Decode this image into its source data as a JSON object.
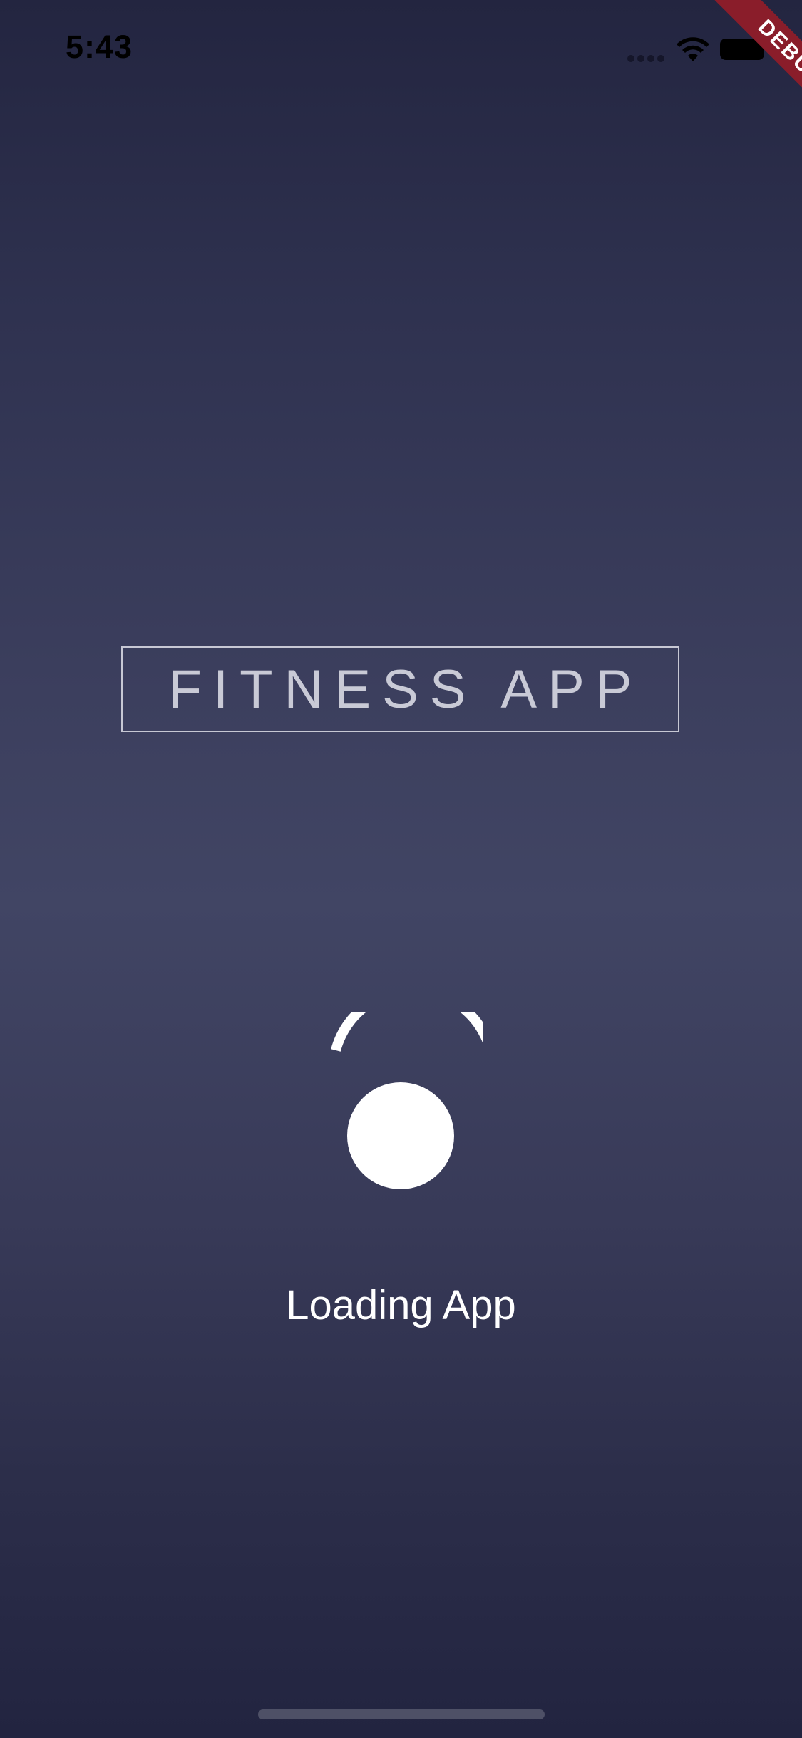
{
  "status_bar": {
    "time": "5:43"
  },
  "debug_banner": {
    "label": "DEBUG",
    "color": "#8a1d2a"
  },
  "splash": {
    "title": "FITNESS APP",
    "loading_label": "Loading App"
  },
  "icons": {
    "signal": "cellular-signal-icon",
    "wifi": "wifi-icon",
    "battery": "battery-icon",
    "spinner": "loading-spinner-icon"
  },
  "colors": {
    "background_top": "#232540",
    "background_mid": "#414564",
    "title_text": "#c9cad6",
    "accent": "#ffffff"
  }
}
